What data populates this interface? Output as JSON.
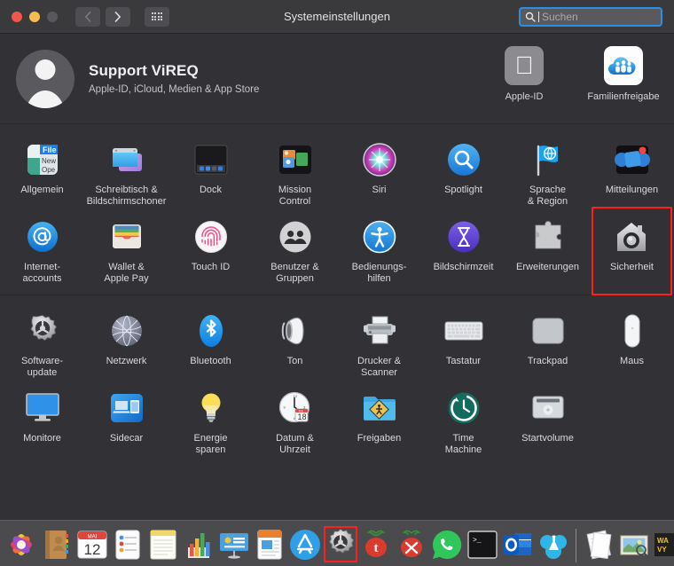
{
  "window": {
    "title": "Systemeinstellungen",
    "traffic_lights": [
      "close",
      "minimize",
      "zoom"
    ],
    "nav": {
      "back_icon": "chevron-left-icon",
      "forward_icon": "chevron-right-icon",
      "grid_icon": "grid-view-icon"
    },
    "search": {
      "placeholder": "Suchen",
      "icon": "search-icon",
      "focused": true
    }
  },
  "account": {
    "name": "Support ViREQ",
    "subtitle": "Apple-ID, iCloud, Medien & App Store",
    "avatar_icon": "user-avatar-icon",
    "tiles": [
      {
        "label": "Apple-ID",
        "icon": "apple-logo-icon"
      },
      {
        "label": "Familienfreigabe",
        "icon": "family-sharing-icon"
      }
    ]
  },
  "sections": [
    {
      "name": "personal",
      "rows": [
        [
          {
            "label": "Allgemein",
            "icon": "general-icon"
          },
          {
            "label": "Schreibtisch &\nBildschirmschoner",
            "icon": "desktop-screensaver-icon"
          },
          {
            "label": "Dock",
            "icon": "dock-icon"
          },
          {
            "label": "Mission\nControl",
            "icon": "mission-control-icon"
          },
          {
            "label": "Siri",
            "icon": "siri-icon"
          },
          {
            "label": "Spotlight",
            "icon": "spotlight-icon"
          },
          {
            "label": "Sprache\n& Region",
            "icon": "language-region-icon"
          },
          {
            "label": "Mitteilungen",
            "icon": "notifications-icon"
          }
        ],
        [
          {
            "label": "Internet-\naccounts",
            "icon": "internet-accounts-icon"
          },
          {
            "label": "Wallet &\nApple Pay",
            "icon": "wallet-applepay-icon"
          },
          {
            "label": "Touch ID",
            "icon": "touch-id-icon"
          },
          {
            "label": "Benutzer &\nGruppen",
            "icon": "users-groups-icon"
          },
          {
            "label": "Bedienungs-\nhilfen",
            "icon": "accessibility-icon"
          },
          {
            "label": "Bildschirmzeit",
            "icon": "screen-time-icon"
          },
          {
            "label": "Erweiterungen",
            "icon": "extensions-icon"
          },
          {
            "label": "Sicherheit",
            "icon": "security-privacy-icon",
            "highlighted": true
          }
        ]
      ]
    },
    {
      "name": "hardware",
      "rows": [
        [
          {
            "label": "Software-\nupdate",
            "icon": "software-update-icon"
          },
          {
            "label": "Netzwerk",
            "icon": "network-icon"
          },
          {
            "label": "Bluetooth",
            "icon": "bluetooth-icon"
          },
          {
            "label": "Ton",
            "icon": "sound-icon"
          },
          {
            "label": "Drucker &\nScanner",
            "icon": "printers-scanners-icon"
          },
          {
            "label": "Tastatur",
            "icon": "keyboard-icon"
          },
          {
            "label": "Trackpad",
            "icon": "trackpad-icon"
          },
          {
            "label": "Maus",
            "icon": "mouse-icon"
          }
        ],
        [
          {
            "label": "Monitore",
            "icon": "displays-icon"
          },
          {
            "label": "Sidecar",
            "icon": "sidecar-icon"
          },
          {
            "label": "Energie\nsparen",
            "icon": "energy-saver-icon"
          },
          {
            "label": "Datum &\nUhrzeit",
            "icon": "date-time-icon",
            "badge_month": "JUL",
            "badge_day": "18"
          },
          {
            "label": "Freigaben",
            "icon": "sharing-icon"
          },
          {
            "label": "Time\nMachine",
            "icon": "time-machine-icon"
          },
          {
            "label": "Startvolume",
            "icon": "startup-disk-icon"
          }
        ]
      ]
    }
  ],
  "dock": {
    "items": [
      {
        "name": "photos",
        "icon": "photos-icon"
      },
      {
        "name": "contacts",
        "icon": "contacts-icon"
      },
      {
        "name": "calendar",
        "icon": "calendar-icon",
        "month": "MAI",
        "day": "12"
      },
      {
        "name": "reminders",
        "icon": "reminders-icon"
      },
      {
        "name": "notes",
        "icon": "notes-icon"
      },
      {
        "name": "numbers",
        "icon": "numbers-icon"
      },
      {
        "name": "keynote",
        "icon": "keynote-icon"
      },
      {
        "name": "pages",
        "icon": "pages-icon"
      },
      {
        "name": "app-store",
        "icon": "app-store-icon"
      },
      {
        "name": "system-preferences",
        "icon": "system-preferences-icon",
        "selected": true
      },
      {
        "name": "tomato-timer",
        "icon": "tomato-icon"
      },
      {
        "name": "tomato-tools",
        "icon": "tomato-tools-icon"
      },
      {
        "name": "whatsapp",
        "icon": "whatsapp-icon"
      },
      {
        "name": "terminal",
        "icon": "terminal-icon"
      },
      {
        "name": "outlook",
        "icon": "outlook-icon"
      },
      {
        "name": "cloud-app",
        "icon": "cloud-icon"
      },
      {
        "name": "separator",
        "icon": "dock-separator"
      },
      {
        "name": "documents-stack",
        "icon": "documents-icon"
      },
      {
        "name": "pictures-stack",
        "icon": "pictures-icon"
      },
      {
        "name": "warning-item",
        "icon": "warning-label-icon"
      }
    ]
  }
}
